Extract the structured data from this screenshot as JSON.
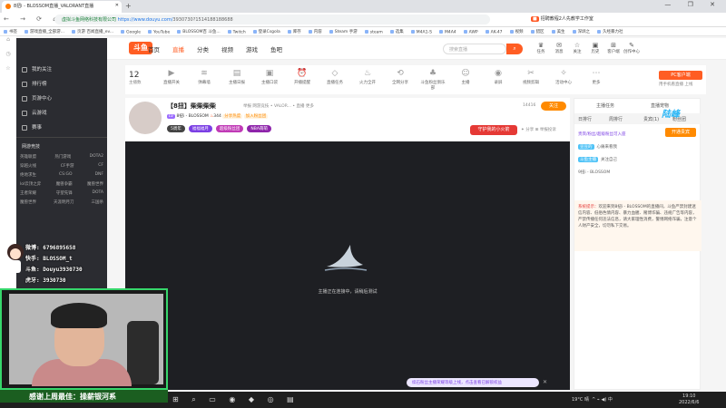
{
  "browser": {
    "tab_title": "8扭i - BLOSSOM直播_VALORANT直播",
    "url_site": "虚拟斗鱼网络科技有限公司",
    "url": "https://www.douyu.com/",
    "url_path": "3930730?1514188188688",
    "ext_label": "招聘教程2人先教学工作室",
    "nav_icons": "← → ⟳ ⌂",
    "win_controls": "— ❐ ✕",
    "new_tab": "+",
    "tab_close": "✕"
  },
  "bookmarks": [
    "书签",
    "游戏直播_全部游...",
    "页游 百闻直播_ev...",
    "Google",
    "YouTube",
    "BLOSSOM百 斗鱼...",
    "Twitch",
    "登录Csgola",
    "库存",
    "内容",
    "Steam 手游",
    "steam",
    "选集",
    "M4A1-S",
    "M4A4",
    "AWP",
    "AK-47",
    "视频",
    "猎区",
    "美生",
    "深圳之",
    "久经暴力社"
  ],
  "sidebar": {
    "items": [
      "我的关注",
      "排行榜",
      "页游中心",
      "云游戏",
      "赛事"
    ],
    "section_title": "网游竞技",
    "grid": [
      [
        "英雄联盟",
        "热门游戏",
        "DOTA2"
      ],
      [
        "穿越火线",
        "CF手游",
        "CF"
      ],
      [
        "绝地求生",
        "CS:GO",
        "DNF"
      ],
      [
        "lol云顶之弈",
        "魔兽争霸",
        "魔兽世界"
      ],
      [
        "王者荣耀",
        "守望先锋",
        "DOTA"
      ],
      [
        "魔兽世界",
        "天涯明月刀",
        "三国杀"
      ]
    ]
  },
  "header": {
    "logo": "斗鱼",
    "nav": [
      "首页",
      "直播",
      "分类",
      "视频",
      "游戏",
      "鱼吧"
    ],
    "active_nav": "直播",
    "search_placeholder": "搜索直播",
    "search_btn": "⌕",
    "icons": [
      {
        "i": "♛",
        "t": "任务"
      },
      {
        "i": "✉",
        "t": "消息"
      },
      {
        "i": "☆",
        "t": "关注"
      },
      {
        "i": "▣",
        "t": "历史"
      },
      {
        "i": "⊞",
        "t": "客户端"
      },
      {
        "i": "✎",
        "t": "创作中心"
      }
    ]
  },
  "categories": {
    "count": "12",
    "count_label": "主播数",
    "items": [
      "直播开关",
      "弹幕墙",
      "主播日报",
      "主播口袋",
      "开播提醒",
      "直播任务",
      "火力全开",
      "全网分享",
      "斗鱼粉丝俱乐部",
      "主播",
      "录屏",
      "视频剪辑",
      "活动中心",
      "更多"
    ],
    "pc_btn": "PC客户端",
    "mobile_btn": "用手机看直播 上线"
  },
  "room": {
    "title": "【8扭】柴柴柴柴",
    "meta": "举报   网游竞技 • VALOR... • 直播  更多",
    "level": "LV",
    "sub": "8扭i - BLOSSOM",
    "heat_icon": "♨",
    "heat": "344",
    "fan_badge": "分享热度",
    "fan_group": "加入粉丝团",
    "pills": [
      "5周年",
      "福福福月",
      "超级粉丝团",
      "NBA萌萌"
    ],
    "viewers": "14416",
    "follow": "关注",
    "gift_btn": "守护我的小火箭",
    "links": "✦ 分享   ⊞ 举报投诉"
  },
  "player": {
    "loading_text": "主播正在连接中，请稍后测试",
    "promo": "续石粉丝主播荣耀等级上线，点击查看已解锁权益",
    "promo_close": "✕"
  },
  "chat": {
    "top": [
      "主播任务",
      "直播宠物"
    ],
    "tabs": [
      "日排行",
      "周排行",
      "贵宾(1)",
      "粉丝团"
    ],
    "brand": "陆峰",
    "open_btn": "开通贵宾",
    "line1": "贵宾/粉丝/超级粉丝可入座",
    "line2_badge": "豆豆的",
    "line2_text": "心痛来看我",
    "line3_badge": "斗鱼主播",
    "line3_text": "关注自己",
    "line4": "9扭i - BLOSSOM",
    "sys_label": "系统提示：",
    "sys_text": "欢迎来到8扭i - BLOSSOM的直播间，斗鱼严禁封建迷信内容、低俗色情内容、暴力血腥、赌博诈骗、违规广告等内容，严禁传播任何违法信息，请大家理性消费，警惕网络诈骗，注意个人财产安全，切勿私下交易。"
  },
  "overlay": {
    "lines": [
      "微博: 6796895658",
      "快手: BLOSSOM_t",
      "斗鱼: Douyu3930730",
      "虎牙: 3930730"
    ],
    "banner": "感谢上周最佳：操薪银河系"
  },
  "taskbar": {
    "icons": "⊞ ⌕ ▭ ◉ ◆ ◎ ▤",
    "weather": "19°C 晴",
    "tray": "^ ⌁ ◀) 中",
    "time": "19:10",
    "date": "2022/6/6"
  }
}
